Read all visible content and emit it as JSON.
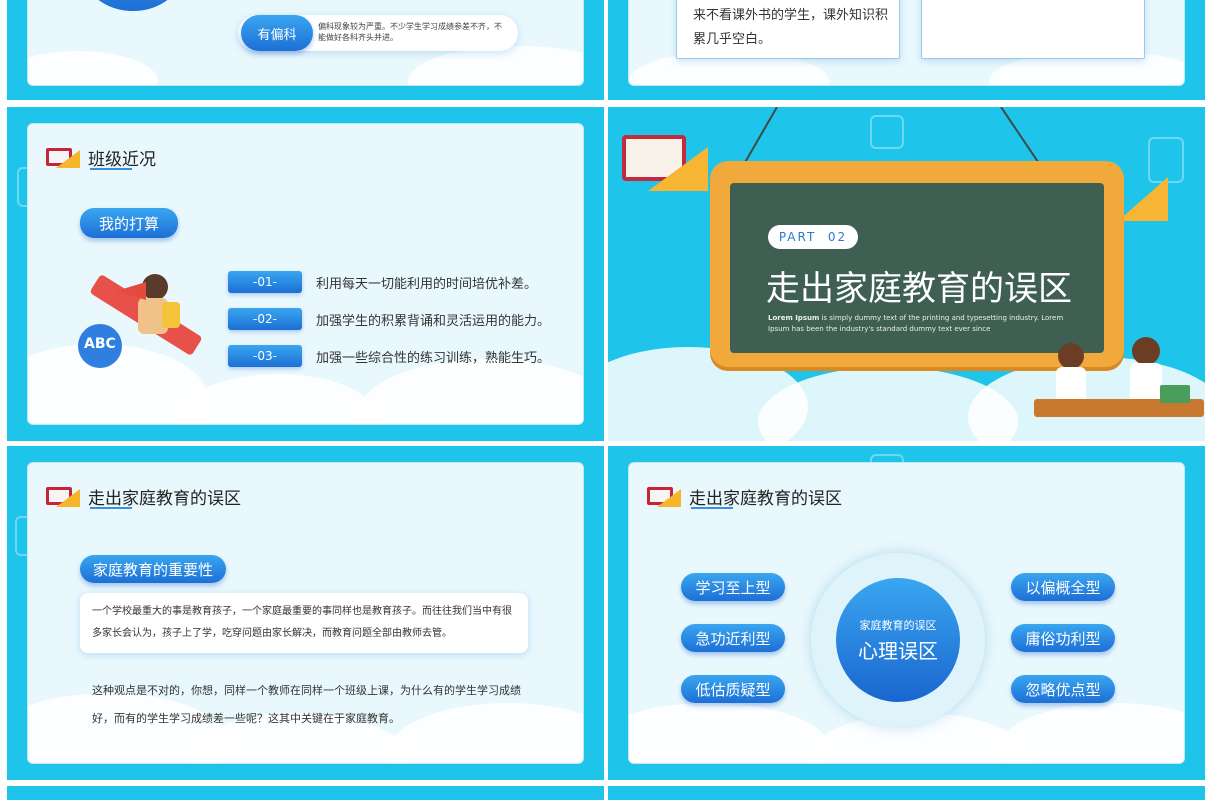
{
  "slide1": {
    "pill_label": "有偏科",
    "pill_desc": "偏科现象较为严重。不少学生学习成绩参差不齐，不能做好各科齐头并进。"
  },
  "slide2": {
    "box_text": "来不看课外书的学生，课外知识积累几乎空白。"
  },
  "slide3": {
    "title": "班级近况",
    "pill": "我的打算",
    "items": [
      {
        "tag": "-01-",
        "text": "利用每天一切能利用的时间培优补差。"
      },
      {
        "tag": "-02-",
        "text": "加强学生的积累背诵和灵活运用的能力。"
      },
      {
        "tag": "-03-",
        "text": "加强一些综合性的练习训练，熟能生巧。"
      }
    ]
  },
  "slide4": {
    "part_label": "PART  02",
    "main_title": "走出家庭教育的误区",
    "lorem_bold": "Lorem Ipsum",
    "lorem_line1": " is simply dummy text of the printing and typesetting industry. Lorem",
    "lorem_line2": "Ipsum has been the industry's standard dummy text ever since"
  },
  "slide5": {
    "title": "走出家庭教育的误区",
    "pill": "家庭教育的重要性",
    "box_text": "一个学校最重大的事是教育孩子，一个家庭最重要的事同样也是教育孩子。而往往我们当中有很多家长会认为，孩子上了学，吃穿问题由家长解决，而教育问题全部由教师去管。",
    "paragraph": "这种观点是不对的，你想，同样一个教师在同样一个班级上课，为什么有的学生学习成绩好，而有的学生学习成绩差一些呢？这其中关键在于家庭教育。"
  },
  "slide6": {
    "title": "走出家庭教育的误区",
    "center_small": "家庭教育的误区",
    "center_big": "心理误区",
    "left_pills": [
      "学习至上型",
      "急功近利型",
      "低估质疑型"
    ],
    "right_pills": [
      "以偏概全型",
      "庸俗功利型",
      "忽略优点型"
    ]
  },
  "colors": {
    "slide_bg": "#1fc4ea",
    "card_bg": "#e9f8fd",
    "accent_blue": "#1d6fd6",
    "board_frame": "#f2a93b",
    "board_green": "#3e5f52"
  }
}
